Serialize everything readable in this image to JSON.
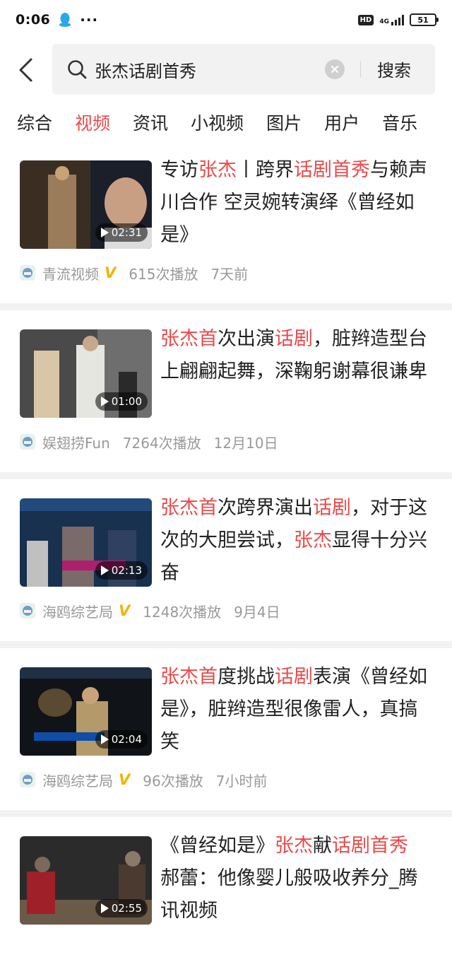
{
  "status_bar": {
    "time": "0:06",
    "dots": "···",
    "hd": "HD",
    "network": "4G",
    "battery": "51"
  },
  "search": {
    "query": "张杰话剧首秀",
    "button_label": "搜索"
  },
  "tabs": [
    {
      "label": "综合",
      "active": false
    },
    {
      "label": "视频",
      "active": true
    },
    {
      "label": "资讯",
      "active": false
    },
    {
      "label": "小视频",
      "active": false
    },
    {
      "label": "图片",
      "active": false
    },
    {
      "label": "用户",
      "active": false
    },
    {
      "label": "音乐",
      "active": false
    }
  ],
  "colors": {
    "accent": "#e94a4a",
    "meta": "#999999",
    "vip": "#f0b400"
  },
  "results": [
    {
      "duration": "02:31",
      "title_parts": [
        {
          "t": "专访",
          "h": false
        },
        {
          "t": "张杰",
          "h": true
        },
        {
          "t": "丨跨界",
          "h": false
        },
        {
          "t": "话剧首秀",
          "h": true
        },
        {
          "t": "与赖声川合作 空灵婉转演绎《曾经如是》",
          "h": false
        }
      ],
      "source": "青流视频",
      "verified": true,
      "verified_mark": "V",
      "plays": "615次播放",
      "date": "7天前"
    },
    {
      "duration": "01:00",
      "title_parts": [
        {
          "t": "张杰首",
          "h": true
        },
        {
          "t": "次出演",
          "h": false
        },
        {
          "t": "话剧",
          "h": true
        },
        {
          "t": "，脏辫造型台上翩翩起舞，深鞠躬谢幕很谦卑",
          "h": false
        }
      ],
      "source": "娱翅捞Fun",
      "verified": false,
      "verified_mark": "",
      "plays": "7264次播放",
      "date": "12月10日"
    },
    {
      "duration": "02:13",
      "title_parts": [
        {
          "t": "张杰首",
          "h": true
        },
        {
          "t": "次跨界演出",
          "h": false
        },
        {
          "t": "话剧",
          "h": true
        },
        {
          "t": "，对于这次的大胆尝试，",
          "h": false
        },
        {
          "t": "张杰",
          "h": true
        },
        {
          "t": "显得十分兴奋",
          "h": false
        }
      ],
      "source": "海鸥综艺局",
      "verified": true,
      "verified_mark": "V",
      "plays": "1248次播放",
      "date": "9月4日"
    },
    {
      "duration": "02:04",
      "title_parts": [
        {
          "t": "张杰首",
          "h": true
        },
        {
          "t": "度挑战",
          "h": false
        },
        {
          "t": "话剧",
          "h": true
        },
        {
          "t": "表演《曾经如是》，脏辫造型很像雷人，真搞笑",
          "h": false
        }
      ],
      "source": "海鸥综艺局",
      "verified": true,
      "verified_mark": "V",
      "plays": "96次播放",
      "date": "7小时前"
    },
    {
      "duration": "02:55",
      "title_parts": [
        {
          "t": "《曾经如是》",
          "h": false
        },
        {
          "t": "张杰",
          "h": true
        },
        {
          "t": "献",
          "h": false
        },
        {
          "t": "话剧首秀",
          "h": true
        },
        {
          "t": " 郝蕾：他像婴儿般吸收养分_腾讯视频",
          "h": false
        }
      ],
      "source": "",
      "verified": false,
      "verified_mark": "",
      "plays": "",
      "date": ""
    }
  ]
}
